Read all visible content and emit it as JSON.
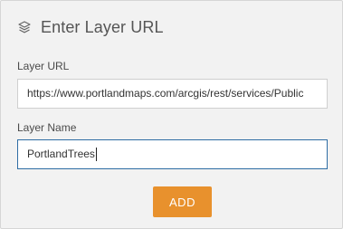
{
  "header": {
    "icon": "layers-icon",
    "title": "Enter Layer URL"
  },
  "form": {
    "url_label": "Layer URL",
    "url_value": "https://www.portlandmaps.com/arcgis/rest/services/Public",
    "name_label": "Layer Name",
    "name_value": "PortlandTrees"
  },
  "actions": {
    "add_label": "ADD"
  },
  "colors": {
    "panel_bg": "#f2f2f2",
    "accent_button": "#e8912d",
    "focus_border": "#2e6da4"
  }
}
